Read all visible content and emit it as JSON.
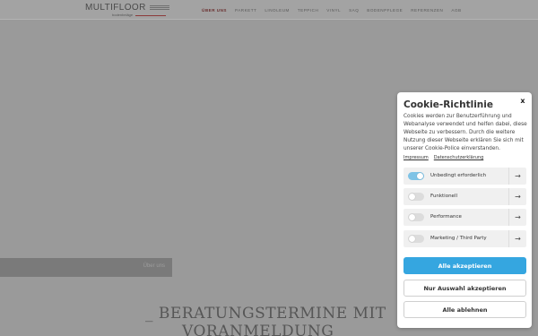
{
  "header": {
    "logo_main": "MULTIFLOOR",
    "logo_sub": "bodenbeläge",
    "nav": [
      "ÜBER UNS",
      "PARKETT",
      "LINOLEUM",
      "TEPPICH",
      "VINYL",
      "SAQ",
      "BODENPFLEGE",
      "REFERENZEN",
      "AGB"
    ]
  },
  "hero": {
    "caption": "Über uns"
  },
  "headline": {
    "line1": "_ BERATUNGSTERMINE MIT",
    "line2": "VORANMELDUNG"
  },
  "cookie": {
    "title": "Cookie-Richtlinie",
    "close": "x",
    "text": "Cookies werden zur Benutzerführung und Webanalyse verwendet und helfen dabei, diese Webseite zu verbessern. Durch die weitere Nutzung dieser Webseite erklären Sie sich mit unserer Cookie-Police einverstanden.",
    "link_impressum": "Impressum",
    "link_privacy": "Datenschutzerklärung",
    "options": [
      {
        "label": "Unbedingt erforderlich",
        "enabled": true
      },
      {
        "label": "Funktionell",
        "enabled": false
      },
      {
        "label": "Performance",
        "enabled": false
      },
      {
        "label": "Marketing / Third Party",
        "enabled": false
      }
    ],
    "arrow": "→",
    "btn_accept_all": "Alle akzeptieren",
    "btn_accept_selection": "Nur Auswahl akzeptieren",
    "btn_reject_all": "Alle ablehnen",
    "accent_color": "#35a6e0"
  }
}
